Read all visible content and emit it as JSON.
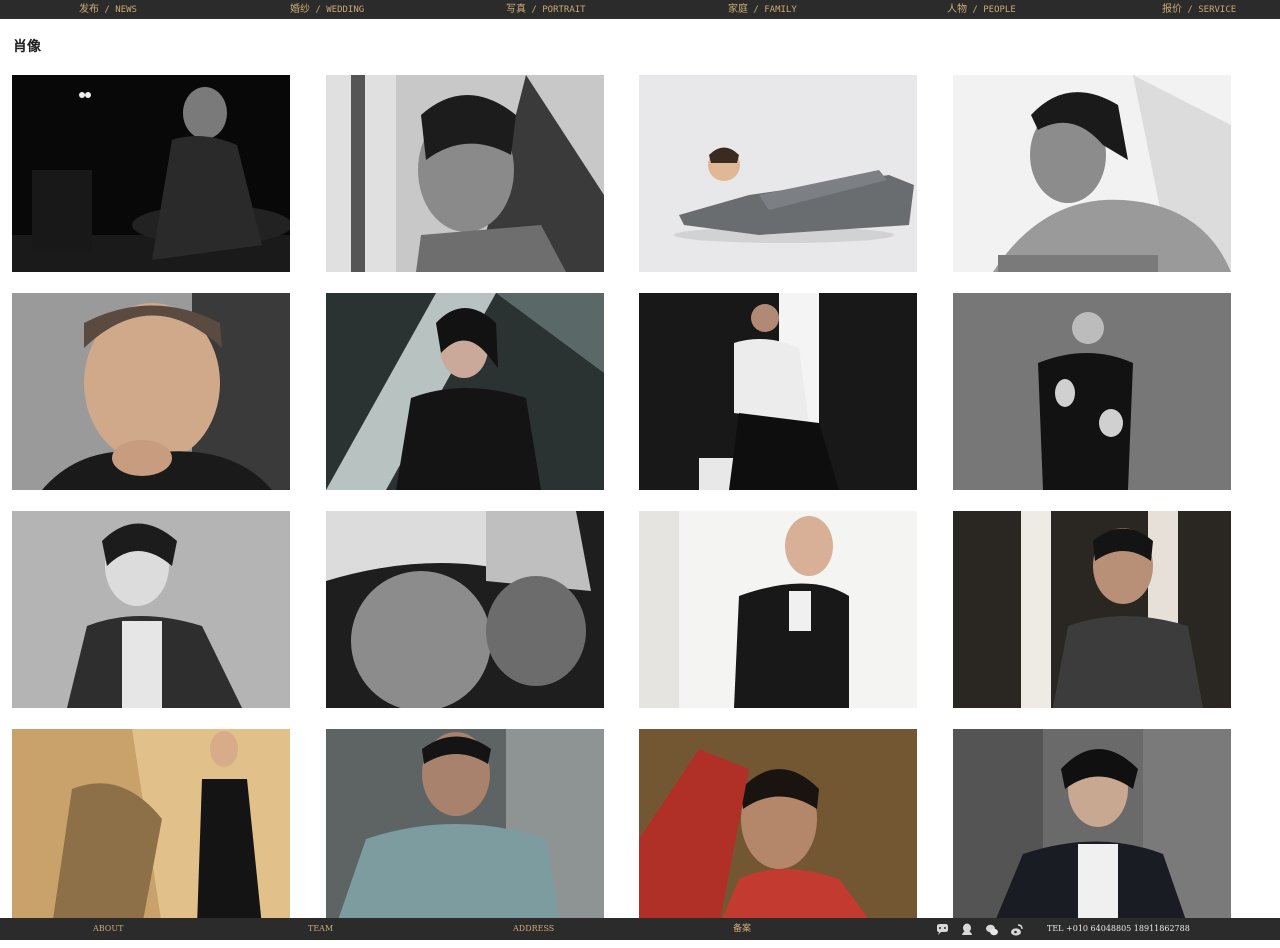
{
  "nav": {
    "items": [
      {
        "cn": "发布",
        "en": " / NEWS"
      },
      {
        "cn": "婚纱",
        "en": " / WEDDING"
      },
      {
        "cn": "写真",
        "en": " / PORTRAIT"
      },
      {
        "cn": "家庭",
        "en": " / FAMILY"
      },
      {
        "cn": "人物",
        "en": " / PEOPLE"
      },
      {
        "cn": "报价",
        "en": " / SERVICE"
      }
    ]
  },
  "page": {
    "title": "肖像"
  },
  "gallery": {
    "photos": [
      {
        "desc": "portrait-1"
      },
      {
        "desc": "portrait-2"
      },
      {
        "desc": "portrait-3"
      },
      {
        "desc": "portrait-4"
      },
      {
        "desc": "portrait-5"
      },
      {
        "desc": "portrait-6"
      },
      {
        "desc": "portrait-7"
      },
      {
        "desc": "portrait-8"
      },
      {
        "desc": "portrait-9"
      },
      {
        "desc": "portrait-10"
      },
      {
        "desc": "portrait-11"
      },
      {
        "desc": "portrait-12"
      },
      {
        "desc": "portrait-13"
      },
      {
        "desc": "portrait-14"
      },
      {
        "desc": "portrait-15"
      },
      {
        "desc": "portrait-16"
      }
    ]
  },
  "footer": {
    "about": "ABOUT",
    "team": "TEAM",
    "address": "ADDRESS",
    "record": "备案",
    "social_icons": [
      "comment-icon",
      "qq-icon",
      "wechat-icon",
      "weibo-icon"
    ],
    "tel": "TEL +010 64048805 18911862788"
  },
  "colors": {
    "bar": "#2b2b2b",
    "accent": "#c9a974"
  }
}
